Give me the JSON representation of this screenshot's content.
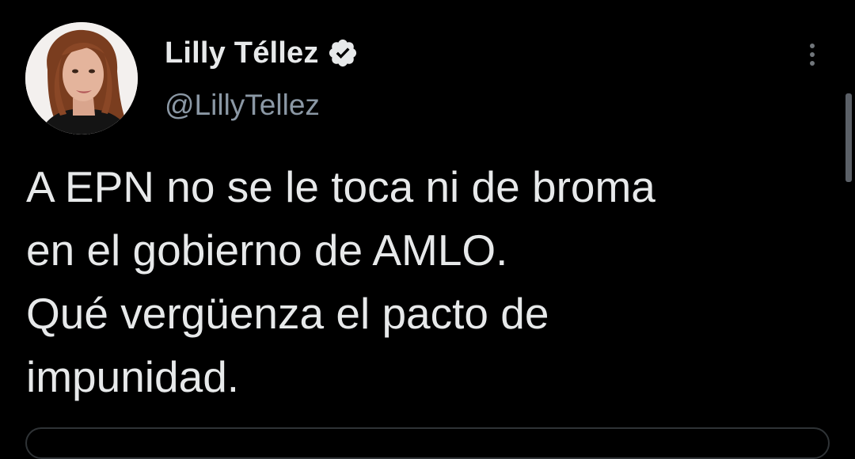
{
  "author": {
    "display_name": "Lilly Téllez",
    "handle": "@LillyTellez",
    "verified": true,
    "avatar_icon": "profile-photo"
  },
  "tweet": {
    "text_lines": [
      "A EPN no se le toca ni de broma",
      "en el gobierno de AMLO.",
      "Qué vergüenza el pacto de",
      "impunidad."
    ]
  },
  "icons": {
    "verified": "verified-badge-icon",
    "more": "more-options-icon"
  },
  "colors": {
    "background": "#000000",
    "primary_text": "#e7e9ea",
    "secondary_text": "#8b98a5",
    "verified_badge": "#e7e9ea",
    "divider": "#2f3336"
  }
}
